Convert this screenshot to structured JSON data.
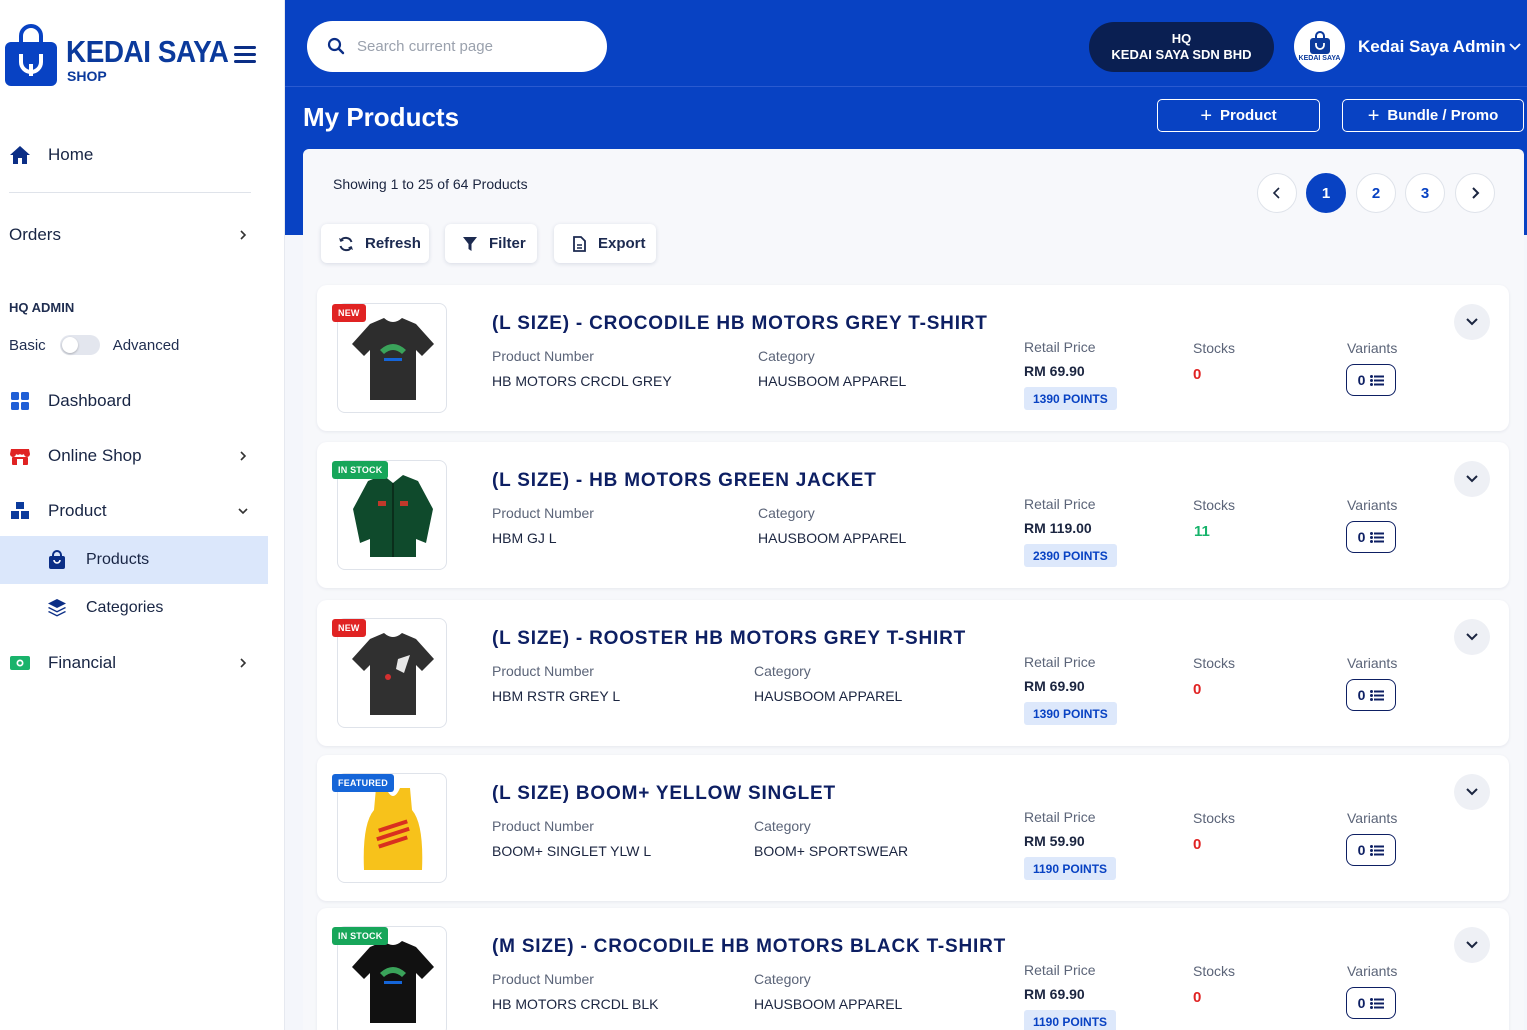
{
  "brand": {
    "name": "KEDAI SAYA",
    "sub": "SHOP"
  },
  "sidebar": {
    "home": "Home",
    "orders": "Orders",
    "section_title": "HQ ADMIN",
    "toggle": {
      "left": "Basic",
      "right": "Advanced"
    },
    "dashboard": "Dashboard",
    "online_shop": "Online Shop",
    "product": "Product",
    "products": "Products",
    "categories": "Categories",
    "financial": "Financial"
  },
  "header": {
    "search_placeholder": "Search current page",
    "hq_line1": "HQ",
    "hq_line2": "KEDAI SAYA SDN BHD",
    "avatar_text": "KEDAI SAYA",
    "admin_name": "Kedai Saya Admin"
  },
  "page": {
    "title": "My Products",
    "add_product": "Product",
    "add_bundle": "Bundle / Promo",
    "showing": "Showing 1 to 25 of 64 Products",
    "pages": [
      "1",
      "2",
      "3"
    ],
    "active_page": "1",
    "toolbar": {
      "refresh": "Refresh",
      "filter": "Filter",
      "export": "Export"
    }
  },
  "labels": {
    "product_number": "Product Number",
    "category": "Category",
    "retail_price": "Retail Price",
    "stocks": "Stocks",
    "variants": "Variants"
  },
  "products": [
    {
      "badge": "NEW",
      "title": "(L SIZE) - CROCODILE HB MOTORS GREY T-SHIRT",
      "number": "HB MOTORS CRCDL GREY",
      "category": "HAUSBOOM APPAREL",
      "price": "RM 69.90",
      "points": "1390 POINTS",
      "stock": "0",
      "variants": "0",
      "color": "#2d2d2d"
    },
    {
      "badge": "IN STOCK",
      "title": "(L SIZE) - HB MOTORS GREEN JACKET",
      "number": "HBM GJ L",
      "category": "HAUSBOOM APPAREL",
      "price": "RM 119.00",
      "points": "2390 POINTS",
      "stock": "11",
      "variants": "0",
      "color": "#0f4a2c"
    },
    {
      "badge": "NEW",
      "title": "(L SIZE) - ROOSTER HB MOTORS GREY T-SHIRT",
      "number": "HBM RSTR GREY L",
      "category": "HAUSBOOM APPAREL",
      "price": "RM 69.90",
      "points": "1390 POINTS",
      "stock": "0",
      "variants": "0",
      "color": "#303030"
    },
    {
      "badge": "FEATURED",
      "title": "(L SIZE) BOOM+ YELLOW SINGLET",
      "number": "BOOM+ SINGLET YLW L",
      "category": "BOOM+ SPORTSWEAR",
      "price": "RM 59.90",
      "points": "1190 POINTS",
      "stock": "0",
      "variants": "0",
      "color": "#f7c21b"
    },
    {
      "badge": "IN STOCK",
      "title": "(M SIZE) - CROCODILE HB MOTORS BLACK T-SHIRT",
      "number": "HB MOTORS CRCDL BLK",
      "category": "HAUSBOOM APPAREL",
      "price": "RM 69.90",
      "points": "1190 POINTS",
      "stock": "0",
      "variants": "0",
      "color": "#111111"
    }
  ],
  "colors": {
    "primary": "#0842c3",
    "navy": "#0d1f63",
    "danger": "#e02323",
    "success": "#17b36b"
  }
}
